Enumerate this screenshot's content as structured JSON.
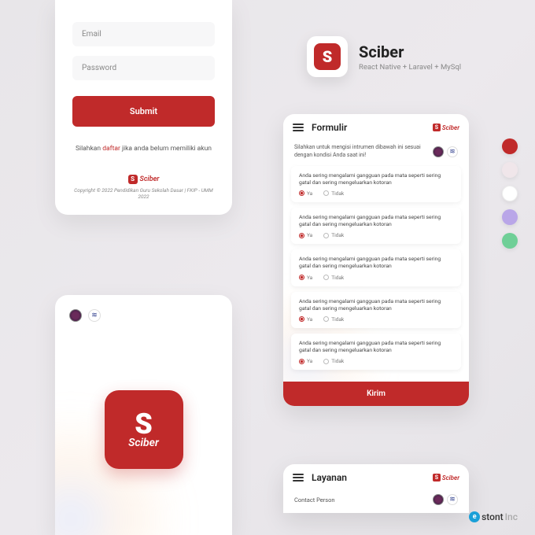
{
  "login": {
    "email_placeholder": "Email",
    "password_placeholder": "Password",
    "submit": "Submit",
    "footer_pre": "Silahkan ",
    "footer_link": "daftar",
    "footer_post": " jika anda belum memiliki akun",
    "brand": "Sciber",
    "copyright": "Copyright © 2022 Pendidikan Guru Sekolah Dasar | FKIP - UMM 2022"
  },
  "splash": {
    "brand": "Sciber"
  },
  "app": {
    "name": "Sciber",
    "subtitle": "React Native + Laravel + MySql"
  },
  "form": {
    "title": "Formulir",
    "brand": "Sciber",
    "intro": "Silahkan untuk mengisi intrumen dibawah ini sesuai dengan kondisi Anda saat ini!",
    "questions": [
      "Anda sering mengalami gangguan pada mata seperti sering gatal dan sering mengeluarkan kotoran",
      "Anda sering mengalami gangguan pada mata seperti sering gatal dan sering mengeluarkan kotoran",
      "Anda sering mengalami gangguan pada mata seperti sering gatal dan sering mengeluarkan kotoran",
      "Anda sering mengalami gangguan pada mata seperti sering gatal dan sering mengeluarkan kotoran",
      "Anda sering mengalami gangguan pada mata seperti sering gatal dan sering mengeluarkan kotoran"
    ],
    "opt_yes": "Ya",
    "opt_no": "Tidak",
    "submit": "Kirim"
  },
  "layanan": {
    "title": "Layanan",
    "brand": "Sciber",
    "contact": "Contact Person"
  },
  "palette": [
    "#c02a2a",
    "#f0e6ea",
    "#ffffff",
    "#b9a6e8",
    "#6fcf97"
  ],
  "watermark": {
    "a": "stont",
    "b": "Inc"
  }
}
